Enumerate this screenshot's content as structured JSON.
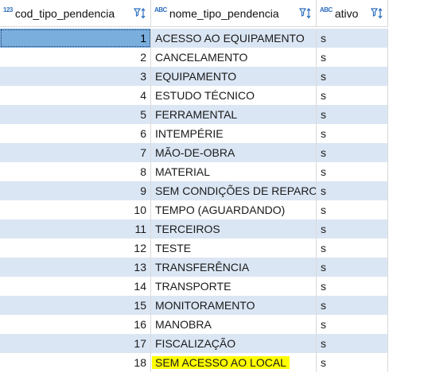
{
  "columns": [
    {
      "type_icon": "123",
      "label": "cod_tipo_pendencia",
      "filter_icon": "filter-sort-icon"
    },
    {
      "type_icon": "ABC",
      "label": "nome_tipo_pendencia",
      "filter_icon": "filter-sort-icon"
    },
    {
      "type_icon": "ABC",
      "label": "ativo",
      "filter_icon": "filter-sort-icon"
    }
  ],
  "rows": [
    {
      "cod": "1",
      "nome": "ACESSO AO EQUIPAMENTO",
      "ativo": "s"
    },
    {
      "cod": "2",
      "nome": "CANCELAMENTO",
      "ativo": "s"
    },
    {
      "cod": "3",
      "nome": "EQUIPAMENTO",
      "ativo": "s"
    },
    {
      "cod": "4",
      "nome": "ESTUDO TÉCNICO",
      "ativo": "s"
    },
    {
      "cod": "5",
      "nome": "FERRAMENTAL",
      "ativo": "s"
    },
    {
      "cod": "6",
      "nome": "INTEMPÉRIE",
      "ativo": "s"
    },
    {
      "cod": "7",
      "nome": "MÃO-DE-OBRA",
      "ativo": "s"
    },
    {
      "cod": "8",
      "nome": "MATERIAL",
      "ativo": "s"
    },
    {
      "cod": "9",
      "nome": "SEM CONDIÇÕES DE REPARO",
      "ativo": "s"
    },
    {
      "cod": "10",
      "nome": "TEMPO (AGUARDANDO)",
      "ativo": "s"
    },
    {
      "cod": "11",
      "nome": "TERCEIROS",
      "ativo": "s"
    },
    {
      "cod": "12",
      "nome": "TESTE",
      "ativo": "s"
    },
    {
      "cod": "13",
      "nome": "TRANSFERÊNCIA",
      "ativo": "s"
    },
    {
      "cod": "14",
      "nome": "TRANSPORTE",
      "ativo": "s"
    },
    {
      "cod": "15",
      "nome": "MONITORAMENTO",
      "ativo": "s"
    },
    {
      "cod": "16",
      "nome": "MANOBRA",
      "ativo": "s"
    },
    {
      "cod": "17",
      "nome": "FISCALIZAÇÃO",
      "ativo": "s"
    },
    {
      "cod": "18",
      "nome": "SEM ACESSO AO LOCAL",
      "ativo": "s"
    }
  ],
  "colors": {
    "row_alt": "#dbe6f4",
    "selected_cell": "#7aaedd",
    "highlight": "#ffff00",
    "type_icon": "#2f6fbf",
    "filter_icon": "#2f6fbf"
  }
}
